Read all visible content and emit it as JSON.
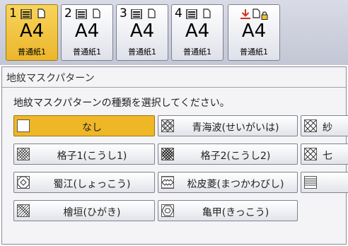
{
  "trays": [
    {
      "num": "1",
      "size": "A4",
      "type": "普通紙1",
      "active": true
    },
    {
      "num": "2",
      "size": "A4",
      "type": "普通紙1",
      "active": false
    },
    {
      "num": "3",
      "size": "A4",
      "type": "普通紙1",
      "active": false
    },
    {
      "num": "4",
      "size": "A4",
      "type": "普通紙1",
      "active": false
    },
    {
      "num": "",
      "size": "A4",
      "type": "普通紙1",
      "active": false
    }
  ],
  "panel": {
    "title": "地紋マスクパターン",
    "instruction": "地紋マスクパターンの種類を選択してください。"
  },
  "patterns": [
    {
      "label": "なし",
      "icon": "blank-pattern-icon",
      "selected": true
    },
    {
      "label": "青海波(せいがいは)",
      "icon": "seigaiha-pattern-icon",
      "selected": false
    },
    {
      "label": "紗",
      "icon": "diamond-pattern-icon",
      "selected": false
    },
    {
      "label": "格子1(こうし1)",
      "icon": "lattice-pattern-icon",
      "selected": false
    },
    {
      "label": "格子2(こうし2)",
      "icon": "lattice2-pattern-icon",
      "selected": false
    },
    {
      "label": "七",
      "icon": "shippo-pattern-icon",
      "selected": false
    },
    {
      "label": "蜀江(しょっこう)",
      "icon": "shokko-pattern-icon",
      "selected": false
    },
    {
      "label": "松皮菱(まつかわびし)",
      "icon": "matsukawabishi-pattern-icon",
      "selected": false
    },
    {
      "label": "",
      "icon": "stripe-pattern-icon",
      "selected": false
    },
    {
      "label": "檜垣(ひがき)",
      "icon": "higaki-pattern-icon",
      "selected": false
    },
    {
      "label": "亀甲(きっこう)",
      "icon": "kikko-pattern-icon",
      "selected": false
    }
  ],
  "colors": {
    "accent": "#efb626",
    "tray_active": "#f0c43e",
    "error_icon": "#d03020"
  }
}
